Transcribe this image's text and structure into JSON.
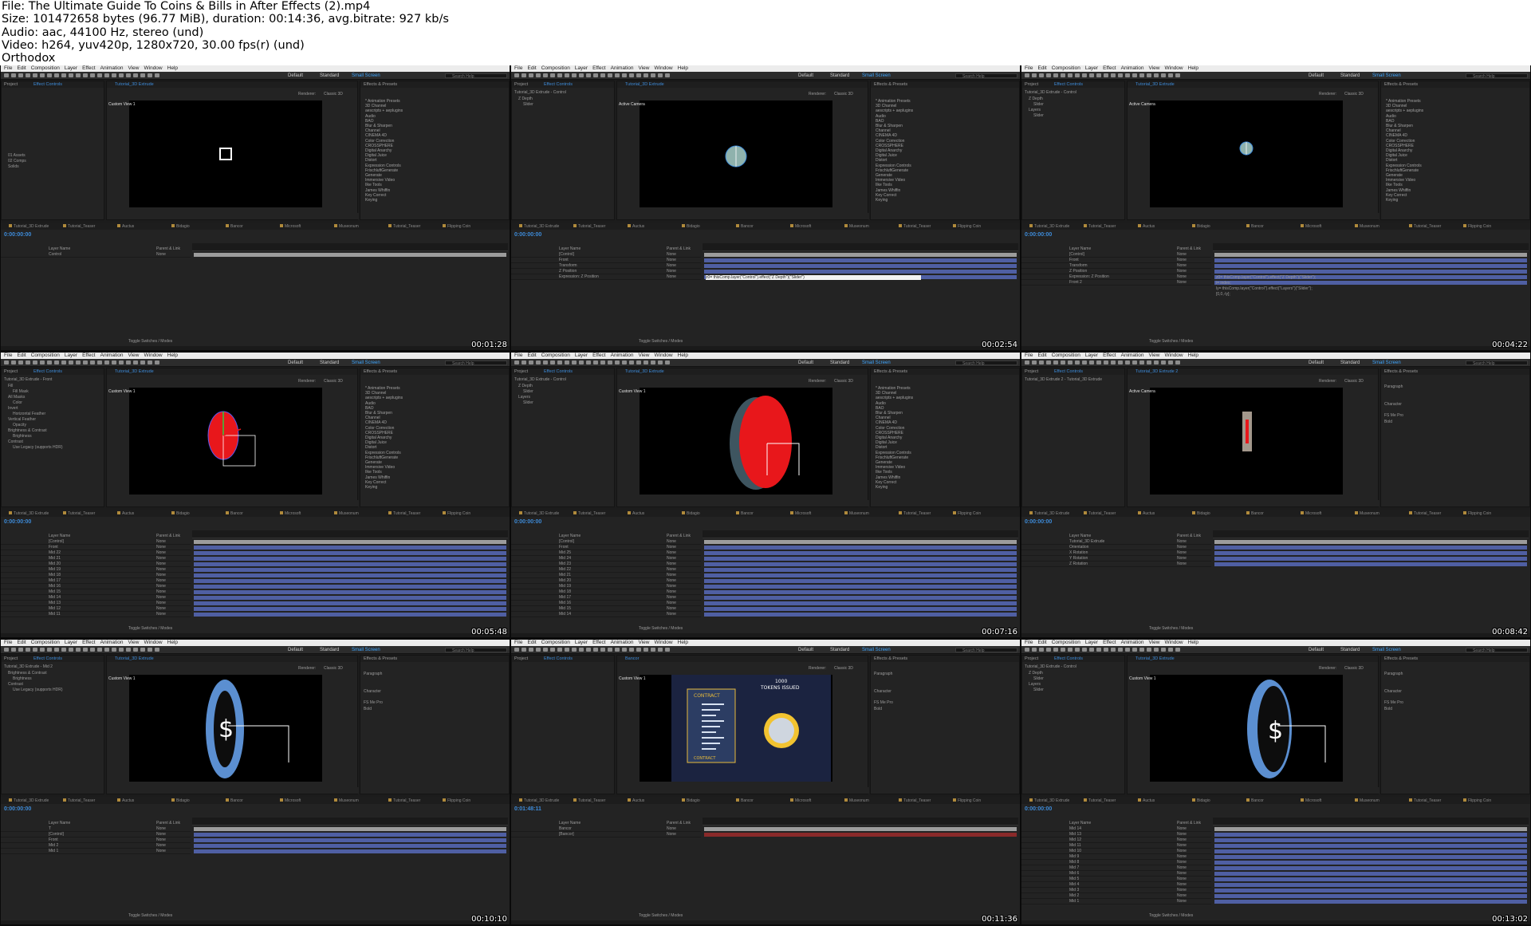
{
  "header": {
    "lines": [
      "File: The Ultimate Guide To Coins & Bills in After Effects (2).mp4",
      "Size: 101472658 bytes (96.77 MiB), duration: 00:14:36, avg.bitrate: 927 kb/s",
      "Audio: aac, 44100 Hz, stereo (und)",
      "Video: h264, yuv420p, 1280x720, 30.00 fps(r) (und)",
      "Orthodox"
    ]
  },
  "app": {
    "menu": [
      "File",
      "Edit",
      "Composition",
      "Layer",
      "Effect",
      "Animation",
      "View",
      "Window",
      "Help"
    ],
    "workspaces": [
      "Default",
      "Standard",
      "Small Screen"
    ],
    "search_placeholder": "Search Help",
    "effects_title": "Effects & Presets",
    "effects": [
      "* Animation Presets",
      "3D Channel",
      "aescripts + aeplugins",
      "Audio",
      "BAO",
      "Blur & Sharpen",
      "Channel",
      "CINEMA 4D",
      "Color Correction",
      "CROSSPHERE",
      "Digital Anarchy",
      "Digital Juice",
      "Distort",
      "Expression Controls",
      "FrischluftGenerate",
      "Generate",
      "Immersive Video",
      "Ilke Tools",
      "James Whiffin",
      "Key Correct",
      "Keying"
    ],
    "project_tab": "Project",
    "effect_controls": "Effect Controls",
    "renderer": "Renderer:",
    "renderer_value": "Classic 3D",
    "active_camera": "Active Camera",
    "custom_view": "Custom View 1",
    "toggle": "Toggle Switches / Modes",
    "layer_name_header": "Layer Name",
    "parent_header": "Parent & Link",
    "none": "None",
    "paragraph": "Paragraph",
    "character": "Character",
    "font": "FS Me Pro",
    "font_style": "Bold"
  },
  "timeline_tabs": [
    "Tutorial_3D Extrude",
    "Tutorial_Teaser",
    "Auctus",
    "Bidagio",
    "Bancor",
    "Microsoft",
    "Museonum",
    "Tutorial_Teaser",
    "Flipping Coin"
  ],
  "tiles": [
    {
      "timestamp": "00:01:28",
      "time": "0:00:00:00",
      "comp": "Tutorial_3D Extrude",
      "ec_title": "",
      "layers": [
        "Control"
      ],
      "project_items": [
        "01 Assets",
        "02 Comps",
        "Solids"
      ]
    },
    {
      "timestamp": "00:02:54",
      "time": "0:00:00:00",
      "comp": "Tutorial_3D Extrude",
      "ec_title": "Tutorial_3D Extrude - Control",
      "ec_rows": [
        "Z Depth",
        "Slider"
      ],
      "layers": [
        "[Control]",
        "Front",
        "Transform",
        "Z Position",
        "Expression: Z Position"
      ],
      "expression": "z0= thisComp.layer(\"Control\").effect(\"Z Depth\")(\"Slider\")"
    },
    {
      "timestamp": "00:04:22",
      "time": "0:00:00:00",
      "comp": "Tutorial_3D Extrude",
      "ec_title": "Tutorial_3D Extrude - Control",
      "ec_rows": [
        "Z Depth",
        "Slider",
        "Layers",
        "Slider"
      ],
      "layers": [
        "[Control]",
        "Front",
        "Transform",
        "Z Position",
        "Expression: Z Position",
        "Front 2"
      ],
      "expressions": [
        "z0= thisComp.layer(\"Control\").effect(\"Z Depth\")(\"Slider\");",
        "i= index;",
        "ly= thisComp.layer(\"Control\").effect(\"Layers\")(\"Slider\");",
        "[0,0,-ly];"
      ]
    },
    {
      "timestamp": "00:05:48",
      "time": "0:00:00:00",
      "comp": "Tutorial_3D Extrude",
      "ec_title": "Tutorial_3D Extrude - Front",
      "ec_rows": [
        "Fill",
        "Fill Mask",
        "All Masks",
        "Color",
        "Invert",
        "Horizontal Feather",
        "Vertical Feather",
        "Opacity",
        "Brightness & Contrast",
        "Brightness",
        "Contrast",
        "Use Legacy (supports HDR)"
      ],
      "layers": [
        "[Control]",
        "Front",
        "Mid 22",
        "Mid 21",
        "Mid 20",
        "Mid 19",
        "Mid 18",
        "Mid 17",
        "Mid 16",
        "Mid 15",
        "Mid 14",
        "Mid 13",
        "Mid 12",
        "Mid 11"
      ]
    },
    {
      "timestamp": "00:07:16",
      "time": "0:00:00:00",
      "comp": "Tutorial_3D Extrude",
      "ec_title": "Tutorial_3D Extrude - Control",
      "ec_rows": [
        "Z Depth",
        "Slider",
        "Layers",
        "Slider"
      ],
      "layers": [
        "[Control]",
        "Front",
        "Mid 25",
        "Mid 24",
        "Mid 23",
        "Mid 22",
        "Mid 21",
        "Mid 20",
        "Mid 19",
        "Mid 18",
        "Mid 17",
        "Mid 16",
        "Mid 15",
        "Mid 14"
      ]
    },
    {
      "timestamp": "00:08:42",
      "time": "0:00:00:00",
      "comp": "Tutorial_3D Extrude 2",
      "ec_title": "Tutorial_3D Extrude 2 - Tutorial_3D Extrude",
      "ec_rows": [],
      "layers": [
        "Tutorial_3D Extrude",
        "Orientation",
        "X Rotation",
        "Y Rotation",
        "Z Rotation"
      ]
    },
    {
      "timestamp": "00:10:10",
      "time": "0:00:00:00",
      "comp": "Tutorial_3D Extrude",
      "ec_title": "Tutorial_3D Extrude - Mid 2",
      "ec_rows": [
        "Brightness & Contrast",
        "Brightness",
        "Contrast",
        "Use Legacy (supports HDR)"
      ],
      "layers": [
        "T",
        "[Control]",
        "Front",
        "Mid 2",
        "Mid 1"
      ]
    },
    {
      "timestamp": "00:11:36",
      "time": "0:01:48:11",
      "comp": "Bancor",
      "ec_title": "",
      "ec_rows": [],
      "layers": [
        "Bancor",
        "[Bancor]"
      ],
      "tokens": "1000",
      "tokens_label": "TOKENS ISSUED",
      "contract": "CONTRACT",
      "contract2": "CONTRACT"
    },
    {
      "timestamp": "00:13:02",
      "time": "0:00:00:00",
      "comp": "Tutorial_3D Extrude",
      "ec_title": "Tutorial_3D Extrude - Control",
      "ec_rows": [
        "Z Depth",
        "Slider",
        "Layers",
        "Slider"
      ],
      "layers": [
        "Mid 14",
        "Mid 13",
        "Mid 12",
        "Mid 11",
        "Mid 10",
        "Mid 9",
        "Mid 8",
        "Mid 7",
        "Mid 6",
        "Mid 5",
        "Mid 4",
        "Mid 3",
        "Mid 2",
        "Mid 1"
      ]
    }
  ],
  "colors": {
    "accent": "#3d8bd9",
    "coin_red": "#e8171b",
    "coin_blue": "#5b8fd1",
    "timeline_bar": "#4f5fa3"
  }
}
